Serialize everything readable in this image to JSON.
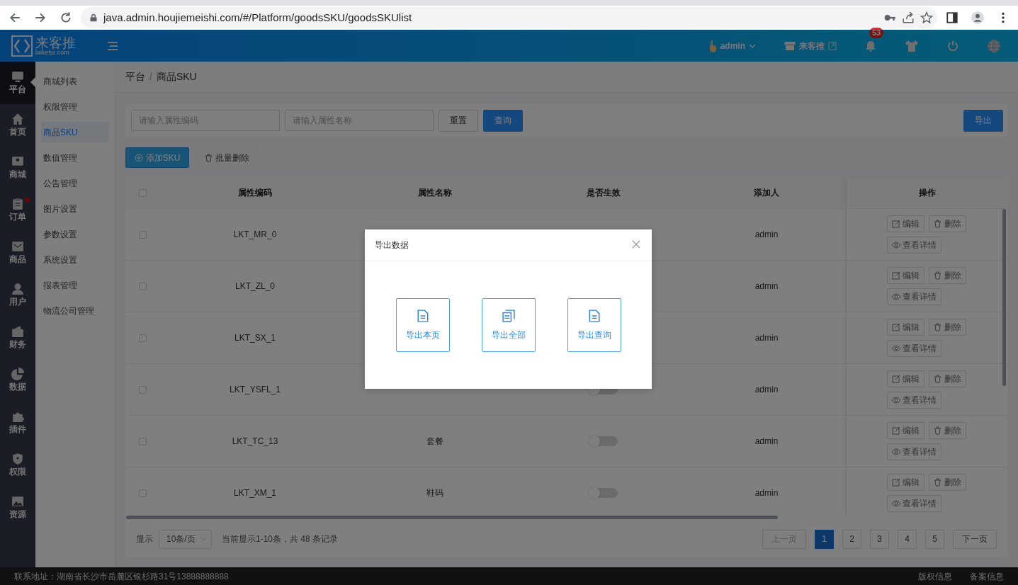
{
  "browser": {
    "url": "java.admin.houjiemeishi.com/#/Platform/goodsSKU/goodsSKUlist"
  },
  "header": {
    "logo_text": "来客推",
    "logo_sub": "laiketui.com",
    "user": "admin",
    "shop": "来客推",
    "notifications": "53"
  },
  "main_nav": [
    {
      "label": "平台",
      "selected": true,
      "dot": false
    },
    {
      "label": "首页",
      "selected": false,
      "dot": false
    },
    {
      "label": "商城",
      "selected": false,
      "dot": false
    },
    {
      "label": "订单",
      "selected": false,
      "dot": true
    },
    {
      "label": "商品",
      "selected": false,
      "dot": false
    },
    {
      "label": "用户",
      "selected": false,
      "dot": false
    },
    {
      "label": "财务",
      "selected": false,
      "dot": false
    },
    {
      "label": "数据",
      "selected": false,
      "dot": false
    },
    {
      "label": "插件",
      "selected": false,
      "dot": false
    },
    {
      "label": "权限",
      "selected": false,
      "dot": false
    },
    {
      "label": "资源",
      "selected": false,
      "dot": false
    }
  ],
  "sub_nav": [
    {
      "label": "商城列表",
      "selected": false
    },
    {
      "label": "权限管理",
      "selected": false
    },
    {
      "label": "商品SKU",
      "selected": true
    },
    {
      "label": "数值管理",
      "selected": false
    },
    {
      "label": "公告管理",
      "selected": false
    },
    {
      "label": "图片设置",
      "selected": false
    },
    {
      "label": "参数设置",
      "selected": false
    },
    {
      "label": "系统设置",
      "selected": false
    },
    {
      "label": "报表管理",
      "selected": false
    },
    {
      "label": "物流公司管理",
      "selected": false
    }
  ],
  "breadcrumb": [
    "平台",
    "商品SKU"
  ],
  "breadcrumb_separator": "/",
  "filters": [
    {
      "placeholder": "请输入属性编码"
    },
    {
      "placeholder": "请输入属性名称"
    }
  ],
  "filter_buttons": [
    {
      "label": "重置",
      "kind": "default"
    },
    {
      "label": "查询",
      "kind": "primary"
    }
  ],
  "export_button": "导出",
  "actions": [
    {
      "label": "添加SKU",
      "kind": "add"
    },
    {
      "label": "批量删除",
      "kind": "delete"
    }
  ],
  "table": {
    "all_checked": false,
    "columns": [
      "属性编码",
      "属性名称",
      "是否生效",
      "添加人",
      "操作"
    ],
    "rows": [
      {
        "checked": false,
        "code": "LKT_MR_0",
        "creator": "admin",
        "actions": [
          "编辑",
          "删除",
          "查看详情"
        ]
      },
      {
        "checked": false,
        "code": "LKT_ZL_0",
        "creator": "admin",
        "actions": [
          "编辑",
          "删除",
          "查看详情"
        ]
      },
      {
        "checked": false,
        "code": "LKT_SX_1",
        "creator": "admin",
        "actions": [
          "编辑",
          "删除",
          "查看详情"
        ]
      },
      {
        "checked": false,
        "code": "LKT_YSFL_1",
        "active": false,
        "creator": "admin",
        "actions": [
          "编辑",
          "删除",
          "查看详情"
        ]
      },
      {
        "checked": false,
        "code": "LKT_TC_13",
        "name": "套餐",
        "active": false,
        "creator": "admin",
        "actions": [
          "编辑",
          "删除",
          "查看详情"
        ]
      },
      {
        "checked": false,
        "code": "LKT_XM_1",
        "name": "鞋码",
        "active": false,
        "creator": "admin",
        "actions": [
          "编辑",
          "删除",
          "查看详情"
        ]
      }
    ]
  },
  "pagination": {
    "show_label": "显示",
    "page_size": "10条/页",
    "summary": "当前显示1-10条，共 48 条记录",
    "prev": {
      "label": "上一页",
      "disabled": true
    },
    "pages": [
      {
        "label": "1",
        "selected": true
      },
      {
        "label": "2",
        "selected": false
      },
      {
        "label": "3",
        "selected": false
      },
      {
        "label": "4",
        "selected": false
      },
      {
        "label": "5",
        "selected": false
      }
    ],
    "next": {
      "label": "下一页",
      "disabled": false
    }
  },
  "footer": {
    "address": "联系地址：湖南省长沙市岳麓区银杉路31号13888888888",
    "links": [
      "版权信息",
      "备案信息"
    ]
  },
  "modal": {
    "title": "导出数据",
    "options": [
      "导出本页",
      "导出全部",
      "导出查询"
    ]
  }
}
